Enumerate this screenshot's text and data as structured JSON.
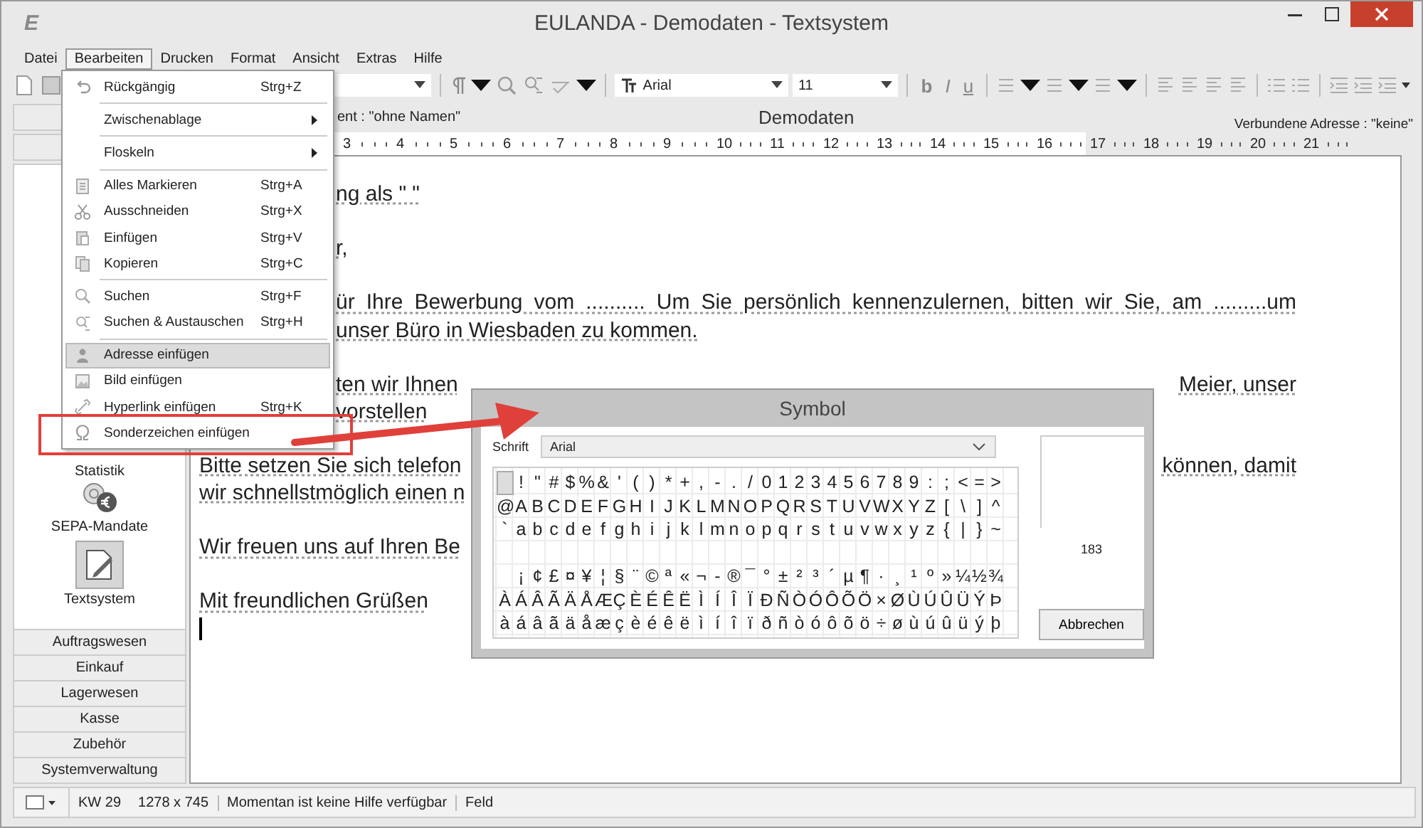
{
  "window": {
    "logo": "E",
    "title": "EULANDA - Demodaten - Textsystem"
  },
  "menu_bar": [
    {
      "label": "Datei",
      "selected": false
    },
    {
      "label": "Bearbeiten",
      "selected": true
    },
    {
      "label": "Drucken",
      "selected": false
    },
    {
      "label": "Format",
      "selected": false
    },
    {
      "label": "Ansicht",
      "selected": false
    },
    {
      "label": "Extras",
      "selected": false
    },
    {
      "label": "Hilfe",
      "selected": false
    }
  ],
  "toolbar": {
    "font": "Arial",
    "size": "11",
    "format_buttons": [
      "b",
      "I",
      "u"
    ]
  },
  "info_bar": {
    "document": "ent : \"ohne Namen\"",
    "center": "Demodaten",
    "address": "Verbundene Adresse : \"keine\""
  },
  "ruler": [
    "3",
    "4",
    "5",
    "6",
    "7",
    "8",
    "9",
    "10",
    "11",
    "12",
    "13",
    "14",
    "15",
    "16",
    "17",
    "18",
    "19",
    "20",
    "21"
  ],
  "sidebar": {
    "modules": [
      {
        "label": "Statistik",
        "kind": "text",
        "selected": false
      },
      {
        "label": "SEPA-Mandate",
        "kind": "coins",
        "selected": false
      },
      {
        "label": "Textsystem",
        "kind": "pen",
        "selected": true
      }
    ],
    "groups": [
      "Auftragswesen",
      "Einkauf",
      "Lagerwesen",
      "Kasse",
      "Zubehör",
      "Systemverwaltung"
    ]
  },
  "document": [
    {
      "kind": "text",
      "hidden_start": true,
      "left": "ng als \" \""
    },
    {
      "kind": "blank"
    },
    {
      "kind": "text",
      "hidden_start": true,
      "left": "r,"
    },
    {
      "kind": "blank"
    },
    {
      "kind": "text",
      "hidden_start": true,
      "justified": true,
      "left": "ür Ihre Bewerbung vom .......... Um Sie persönlich kennenzulernen, bitten wir Sie, am .........um"
    },
    {
      "kind": "text",
      "hidden_start": true,
      "left": "unser Büro in Wiesbaden zu kommen."
    },
    {
      "kind": "blank"
    },
    {
      "kind": "text",
      "hidden_start": true,
      "left": "ten wir Ihnen",
      "right": "Meier, unser"
    },
    {
      "kind": "text",
      "hidden_start": true,
      "left": "vorstellen"
    },
    {
      "kind": "blank"
    },
    {
      "kind": "text",
      "hidden_start": false,
      "left": "Bitte setzen Sie sich telefon",
      "right": "können, damit"
    },
    {
      "kind": "text",
      "hidden_start": false,
      "left": "wir schnellstmöglich einen n"
    },
    {
      "kind": "blank"
    },
    {
      "kind": "text",
      "hidden_start": false,
      "left": "Wir freuen uns auf Ihren Be"
    },
    {
      "kind": "blank"
    },
    {
      "kind": "text",
      "hidden_start": false,
      "left": "Mit freundlichen Grüßen"
    },
    {
      "kind": "cursor"
    }
  ],
  "edit_menu": [
    {
      "kind": "item",
      "label": "Rückgängig",
      "shortcut": "Strg+Z",
      "highlighted": false
    },
    {
      "kind": "separator"
    },
    {
      "kind": "submenu",
      "label": "Zwischenablage",
      "highlighted": false
    },
    {
      "kind": "separator"
    },
    {
      "kind": "submenu",
      "label": "Floskeln",
      "highlighted": false
    },
    {
      "kind": "separator"
    },
    {
      "kind": "item",
      "label": "Alles Markieren",
      "shortcut": "Strg+A",
      "highlighted": false
    },
    {
      "kind": "item",
      "label": "Ausschneiden",
      "shortcut": "Strg+X",
      "highlighted": false
    },
    {
      "kind": "item",
      "label": "Einfügen",
      "shortcut": "Strg+V",
      "highlighted": false
    },
    {
      "kind": "item",
      "label": "Kopieren",
      "shortcut": "Strg+C",
      "highlighted": false
    },
    {
      "kind": "separator"
    },
    {
      "kind": "item",
      "label": "Suchen",
      "shortcut": "Strg+F",
      "highlighted": false
    },
    {
      "kind": "item",
      "label": "Suchen & Austauschen",
      "shortcut": "Strg+H",
      "highlighted": false
    },
    {
      "kind": "separator"
    },
    {
      "kind": "item",
      "label": "Adresse einfügen",
      "highlighted": true
    },
    {
      "kind": "item",
      "label": "Bild einfügen",
      "highlighted": false
    },
    {
      "kind": "item",
      "label": "Hyperlink einfügen",
      "shortcut": "Strg+K",
      "highlighted": false
    },
    {
      "kind": "item",
      "label": "Sonderzeichen einfügen",
      "highlighted": false
    }
  ],
  "symbol_dialog": {
    "title": "Symbol",
    "font_label": "Schrift",
    "font": "Arial",
    "first_cell_selected": true,
    "rows": [
      {
        "kind": "offset",
        "chars": [
          "!",
          "\"",
          "#",
          "$",
          "%",
          "&",
          "'",
          "(",
          ")",
          "*",
          "+",
          ",",
          "-",
          ".",
          "/",
          "0",
          "1",
          "2",
          "3",
          "4",
          "5",
          "6",
          "7",
          "8",
          "9",
          ":",
          ";",
          "<",
          "=",
          ">"
        ]
      },
      {
        "kind": "full",
        "chars": [
          "@",
          "A",
          "B",
          "C",
          "D",
          "E",
          "F",
          "G",
          "H",
          "I",
          "J",
          "K",
          "L",
          "M",
          "N",
          "O",
          "P",
          "Q",
          "R",
          "S",
          "T",
          "U",
          "V",
          "W",
          "X",
          "Y",
          "Z",
          "[",
          "\\",
          "]",
          "^"
        ]
      },
      {
        "kind": "full",
        "chars": [
          "`",
          "a",
          "b",
          "c",
          "d",
          "e",
          "f",
          "g",
          "h",
          "i",
          "j",
          "k",
          "l",
          "m",
          "n",
          "o",
          "p",
          "q",
          "r",
          "s",
          "t",
          "u",
          "v",
          "w",
          "x",
          "y",
          "z",
          "{",
          "|",
          "}",
          "~"
        ]
      },
      {
        "kind": "blank"
      },
      {
        "kind": "offset",
        "chars": [
          "¡",
          "¢",
          "£",
          "¤",
          "¥",
          "¦",
          "§",
          "¨",
          "©",
          "ª",
          "«",
          "¬",
          "-",
          "®",
          "¯",
          "°",
          "±",
          "²",
          "³",
          "´",
          "µ",
          "¶",
          "·",
          "¸",
          "¹",
          "º",
          "»",
          "¼",
          "½",
          "¾"
        ]
      },
      {
        "kind": "full",
        "chars": [
          "À",
          "Á",
          "Â",
          "Ã",
          "Ä",
          "Å",
          "Æ",
          "Ç",
          "È",
          "É",
          "Ê",
          "Ë",
          "Ì",
          "Í",
          "Î",
          "Ï",
          "Ð",
          "Ñ",
          "Ò",
          "Ó",
          "Ô",
          "Õ",
          "Ö",
          "×",
          "Ø",
          "Ù",
          "Ú",
          "Û",
          "Ü",
          "Ý",
          "Þ"
        ]
      },
      {
        "kind": "full",
        "chars": [
          "à",
          "á",
          "â",
          "ã",
          "ä",
          "å",
          "æ",
          "ç",
          "è",
          "é",
          "ê",
          "ë",
          "ì",
          "í",
          "î",
          "ï",
          "ð",
          "ñ",
          "ò",
          "ó",
          "ô",
          "õ",
          "ö",
          "÷",
          "ø",
          "ù",
          "ú",
          "û",
          "ü",
          "ý",
          "þ"
        ]
      }
    ],
    "code": "183",
    "cancel": "Abbrechen"
  },
  "status_bar": {
    "week": "KW 29",
    "resolution": "1278 x 745",
    "help": "Momentan ist keine Hilfe verfügbar",
    "mode": "Feld"
  }
}
